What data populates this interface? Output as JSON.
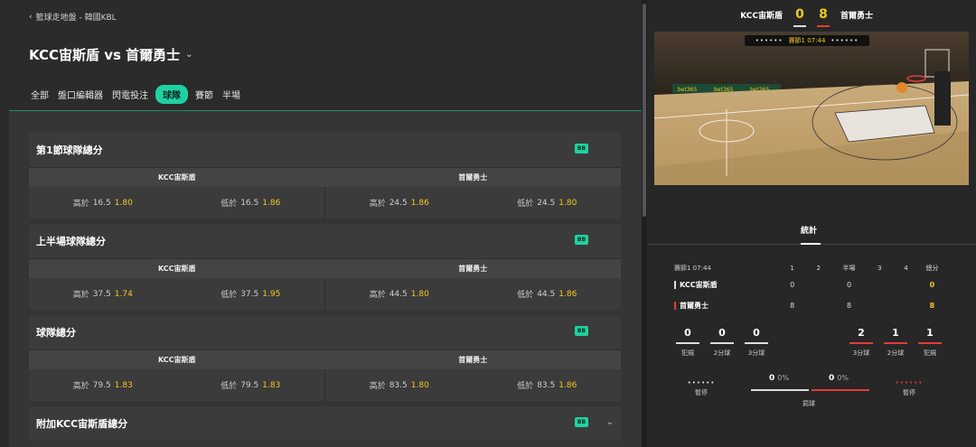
{
  "breadcrumb": "籃球走地盤 - 韓國KBL",
  "match_title": "KCC宙斯盾 vs 首爾勇士",
  "tabs": [
    "全部",
    "盤口編輯器",
    "閃電投注",
    "球隊",
    "賽節",
    "半場"
  ],
  "active_tab": "球隊",
  "badge": "BB",
  "home_team": "KCC宙斯盾",
  "away_team": "首爾勇士",
  "over_label": "高於",
  "under_label": "低於",
  "markets": [
    {
      "title": "第1節球隊總分",
      "home": {
        "over_line": "16.5",
        "over_odds": "1.80",
        "under_line": "16.5",
        "under_odds": "1.86"
      },
      "away": {
        "over_line": "24.5",
        "over_odds": "1.86",
        "under_line": "24.5",
        "under_odds": "1.80"
      }
    },
    {
      "title": "上半場球隊總分",
      "home": {
        "over_line": "37.5",
        "over_odds": "1.74",
        "under_line": "37.5",
        "under_odds": "1.95"
      },
      "away": {
        "over_line": "44.5",
        "over_odds": "1.80",
        "under_line": "44.5",
        "under_odds": "1.86"
      }
    },
    {
      "title": "球隊總分",
      "home": {
        "over_line": "79.5",
        "over_odds": "1.83",
        "under_line": "79.5",
        "under_odds": "1.83"
      },
      "away": {
        "over_line": "83.5",
        "over_odds": "1.80",
        "under_line": "83.5",
        "under_odds": "1.86"
      }
    }
  ],
  "collapsed_market": "附加KCC宙斯盾總分",
  "scoreboard": {
    "home_score": "0",
    "away_score": "8",
    "clock_label": "賽節1 07:44",
    "clock_dots": "••••••"
  },
  "court_ads": [
    "bet365",
    "bet365",
    "bet365"
  ],
  "stats_tab": "統計",
  "stats_table": {
    "period": "賽節1 07:44",
    "headers": [
      "1",
      "2",
      "半場",
      "3",
      "4",
      "總分"
    ],
    "rows": [
      {
        "team": "KCC宙斯盾",
        "q1": "0",
        "half": "0",
        "total": "0"
      },
      {
        "team": "首爾勇士",
        "q1": "8",
        "half": "8",
        "total": "8"
      }
    ]
  },
  "home_stats": [
    {
      "value": "0",
      "label": "犯規"
    },
    {
      "value": "0",
      "label": "2分球"
    },
    {
      "value": "0",
      "label": "3分球"
    }
  ],
  "away_stats": [
    {
      "value": "2",
      "label": "3分球"
    },
    {
      "value": "1",
      "label": "2分球"
    },
    {
      "value": "1",
      "label": "犯規"
    }
  ],
  "timeouts_label": "暫停",
  "timeout_dots": "••••••",
  "free_throws": {
    "label": "罰球",
    "home_value": "0",
    "home_pct": "0%",
    "away_value": "0",
    "away_pct": "0%"
  },
  "colors": {
    "accent": "#1fd1a1",
    "odds": "#f2c81f",
    "away": "#e33b3b"
  }
}
